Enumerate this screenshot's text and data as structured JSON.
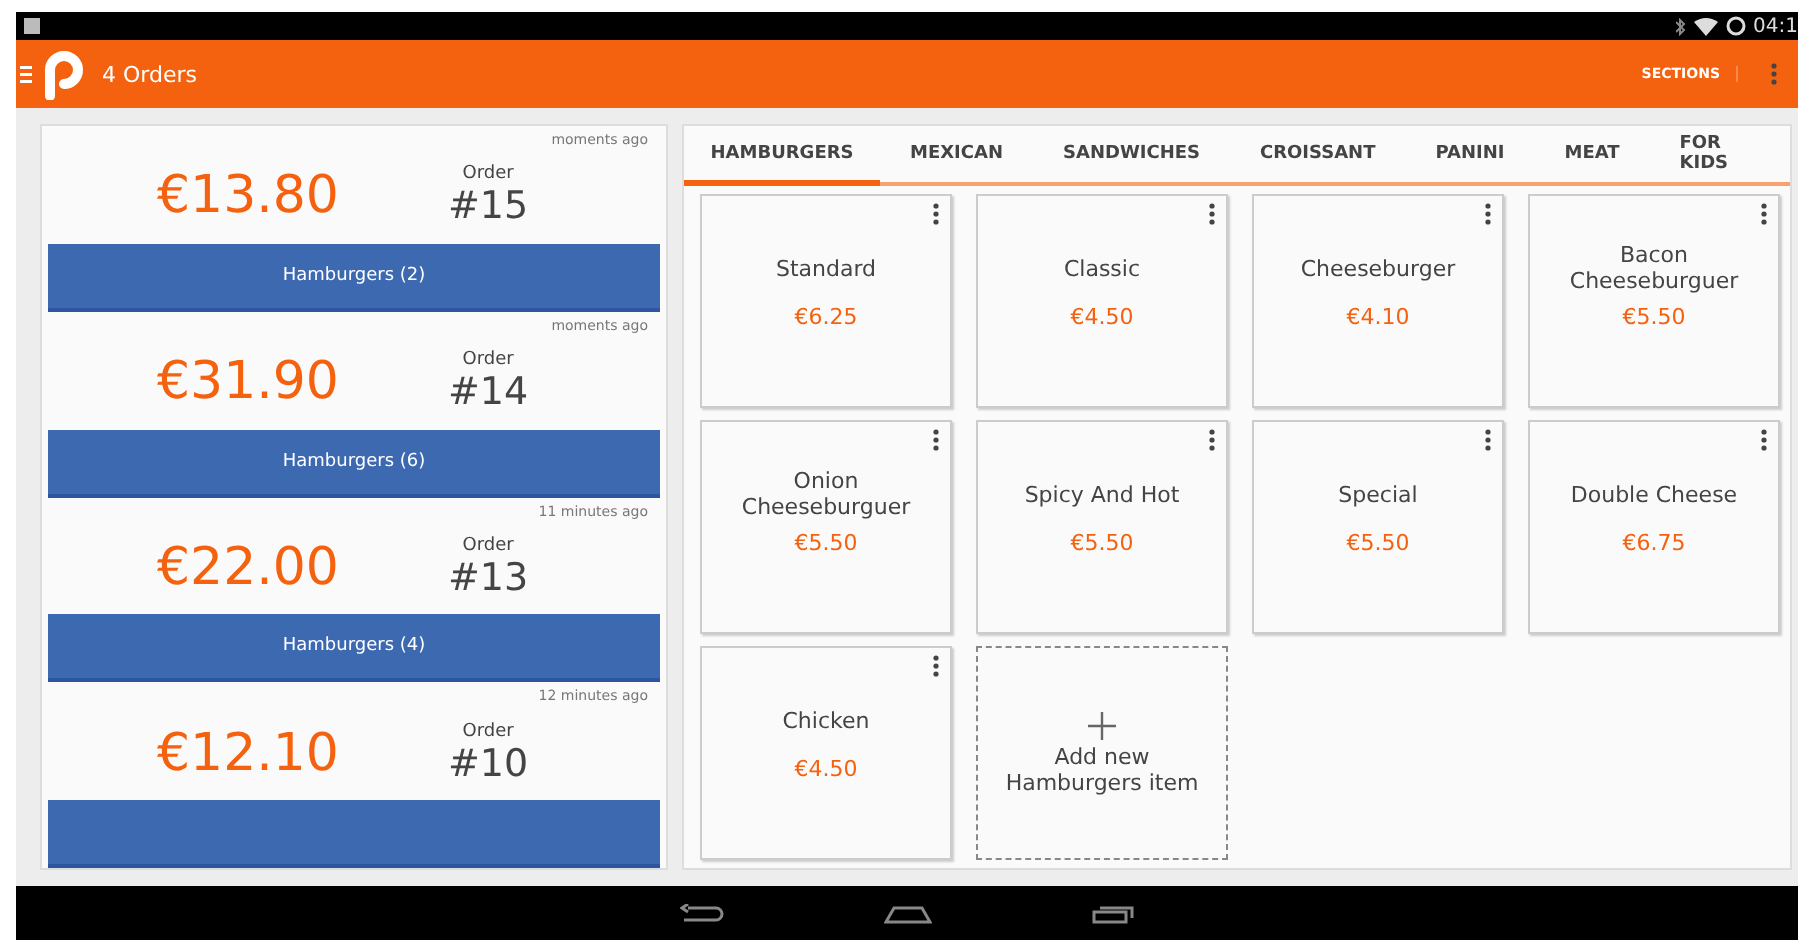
{
  "status_bar": {
    "time": "04:1"
  },
  "app_bar": {
    "title": "4 Orders",
    "action": "SECTIONS"
  },
  "orders": [
    {
      "time": "moments ago",
      "total": "€13.80",
      "label": "Order",
      "number": "#15",
      "category": "Hamburgers (2)"
    },
    {
      "time": "moments ago",
      "total": "€31.90",
      "label": "Order",
      "number": "#14",
      "category": "Hamburgers (6)"
    },
    {
      "time": "11 minutes ago",
      "total": "€22.00",
      "label": "Order",
      "number": "#13",
      "category": "Hamburgers (4)"
    },
    {
      "time": "12 minutes ago",
      "total": "€12.10",
      "label": "Order",
      "number": "#10"
    }
  ],
  "tabs": [
    {
      "label": "HAMBURGERS",
      "selected": true
    },
    {
      "label": "MEXICAN",
      "selected": false
    },
    {
      "label": "SANDWICHES",
      "selected": false
    },
    {
      "label": "CROISSANT",
      "selected": false
    },
    {
      "label": "PANINI",
      "selected": false
    },
    {
      "label": "MEAT",
      "selected": false
    },
    {
      "label": "FOR KIDS",
      "selected": false
    }
  ],
  "items": [
    {
      "kind": "product",
      "name": "Standard",
      "price": "€6.25"
    },
    {
      "kind": "product",
      "name": "Classic",
      "price": "€4.50"
    },
    {
      "kind": "product",
      "name": "Cheeseburger",
      "price": "€4.10"
    },
    {
      "kind": "product",
      "name": "Bacon Cheeseburguer",
      "price": "€5.50"
    },
    {
      "kind": "product",
      "name": "Onion Cheeseburguer",
      "price": "€5.50"
    },
    {
      "kind": "product",
      "name": "Spicy And Hot",
      "price": "€5.50"
    },
    {
      "kind": "product",
      "name": "Special",
      "price": "€5.50"
    },
    {
      "kind": "product",
      "name": "Double Cheese",
      "price": "€6.75"
    },
    {
      "kind": "product",
      "name": "Chicken",
      "price": "€4.50"
    },
    {
      "kind": "add",
      "name": "Add new Hamburgers item"
    }
  ]
}
